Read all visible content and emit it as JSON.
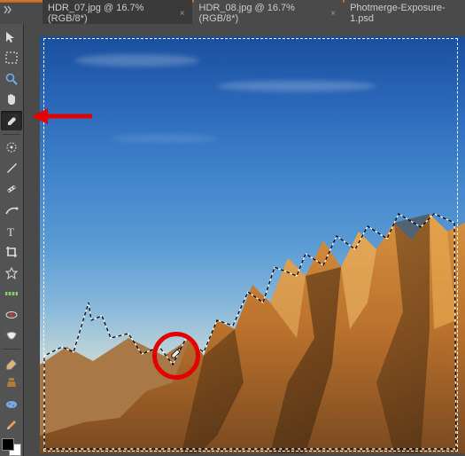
{
  "tabs": [
    {
      "label": "HDR_07.jpg @ 16.7% (RGB/8*)",
      "closed": false
    },
    {
      "label": "HDR_08.jpg @ 16.7% (RGB/8*)",
      "closed": false
    },
    {
      "label": "Photmerge-Exposure-1.psd",
      "closed": false
    }
  ],
  "tools": {
    "move": "Move",
    "marquee": "Rectangular Marquee",
    "zoom": "Zoom",
    "hand": "Hand",
    "eyedropper": "Eyedropper",
    "selection": "Quick Selection",
    "brush": "Brush",
    "heal": "Spot Healing",
    "patch": "Patch",
    "type": "Type",
    "crop": "Crop",
    "frame": "Cookie Cutter",
    "straighten": "Straighten",
    "redeye": "Red Eye",
    "whiten": "Whiten Teeth",
    "eraser": "Eraser",
    "stamp": "Clone Stamp",
    "sponge": "Sponge",
    "pencil": "Pencil"
  },
  "close_glyph": "×",
  "expand_glyph": "▸▸"
}
